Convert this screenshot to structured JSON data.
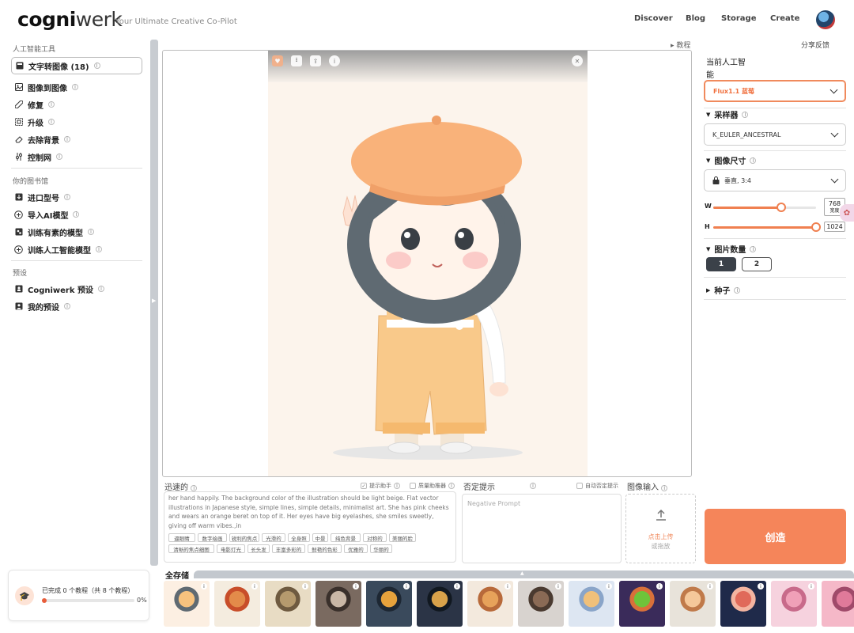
{
  "header": {
    "logo_bold": "cogni",
    "logo_light": "werk",
    "tagline": "Your Ultimate Creative Co-Pilot",
    "nav": [
      "Discover",
      "Blog",
      "Storage",
      "Create"
    ]
  },
  "sidebar": {
    "sections": [
      {
        "title": "人工智能工具",
        "items": [
          {
            "label": "文字转图像 (18)",
            "icon": "text-to-image-icon",
            "active": true
          },
          {
            "label": "图像到图像",
            "icon": "image-icon"
          },
          {
            "label": "修复",
            "icon": "bandage-icon"
          },
          {
            "label": "升级",
            "icon": "upscale-icon"
          },
          {
            "label": "去除背景",
            "icon": "eraser-icon"
          },
          {
            "label": "控制网",
            "icon": "sliders-icon"
          }
        ]
      },
      {
        "title": "你的图书馆",
        "items": [
          {
            "label": "进口型号",
            "icon": "import-icon"
          },
          {
            "label": "导入AI模型",
            "icon": "plus-circle-icon"
          },
          {
            "label": "训练有素的模型",
            "icon": "model-icon"
          },
          {
            "label": "训练人工智能模型",
            "icon": "plus-circle-icon"
          }
        ]
      },
      {
        "title": "预设",
        "items": [
          {
            "label": "Cogniwerk 预设",
            "icon": "preset-icon"
          },
          {
            "label": "我的预设",
            "icon": "user-icon"
          }
        ]
      }
    ]
  },
  "canvas": {
    "tutorial_link": "教程"
  },
  "right_panel": {
    "feedback": "分享反馈",
    "current_model_label_line1": "当前人工智",
    "current_model_label_line2": "能",
    "model_value": "Flux1.1 蓝莓",
    "sampler_label": "采样器",
    "sampler_value": "K_EULER_ANCESTRAL",
    "size_label": "图像尺寸",
    "size_value": "垂直, 3:4",
    "width_label": "W",
    "width_value": "768",
    "width_fraction": 0.66,
    "height_label": "H",
    "height_value": "1024",
    "height_fraction": 1.0,
    "width_unit": "宽度",
    "count_label": "图片数量",
    "count_options": [
      "1",
      "2"
    ],
    "count_selected": "1",
    "seed_label": "种子",
    "create_button": "创造"
  },
  "prompt": {
    "title": "迅速的",
    "assist_label": "提示助手",
    "enhance_label": "质量助推器",
    "text": "her hand happily. The background color of the illustration should be light beige. Flat vector illustrations in Japanese style, simple lines, simple details, minimalist art. She has pink cheeks and wears an orange beret on top of it. Her eyes have big eyelashes, she smiles sweetly, giving off warm vibes.,in",
    "tags_row1": [
      "逼眼睛",
      "数字绘画",
      "锐利的焦点",
      "光滑的",
      "全身照",
      "中景",
      "纯色背景",
      "对称的",
      "美丽的脸"
    ],
    "tags_row2": [
      "清晰的焦点细图",
      "电影灯光",
      "长头发",
      "丰富多彩的",
      "鲜艳的色彩",
      "优雅的",
      "华丽的"
    ]
  },
  "negative": {
    "title": "否定提示",
    "auto_label": "自动否定提示",
    "placeholder": "Negative Prompt"
  },
  "image_input": {
    "title": "图像输入",
    "upload_label": "点击上传",
    "or_drop": "或拖放"
  },
  "storage": {
    "label": "全存储",
    "thumbnail_count": 14
  },
  "progress": {
    "text": "已完成 0 个教程（共 8 个教程）",
    "percent": "0%",
    "fraction": 0
  },
  "colors": {
    "accent": "#f5855a",
    "accent_border": "#f08a5d",
    "dark_button": "#3b4149"
  }
}
